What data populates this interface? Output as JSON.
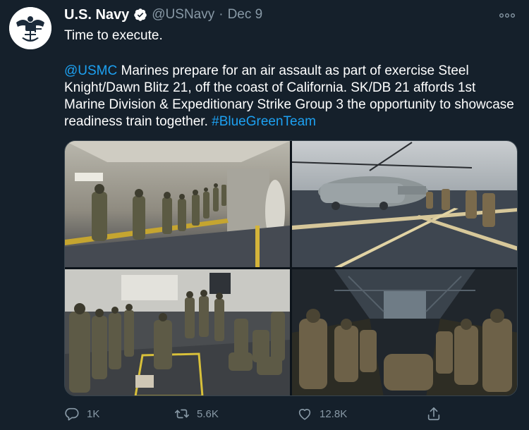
{
  "tweet": {
    "display_name": "U.S. Navy",
    "handle": "@USNavy",
    "separator": "·",
    "date": "Dec 9",
    "first_line": "Time to execute.",
    "mention": "@USMC",
    "body": " Marines prepare for an air assault as part of exercise Steel Knight/Dawn Blitz 21, off the coast of California. SK/DB 21 affords 1st Marine Division & Expeditionary Strike Group 3 the opportunity to showcase readiness train together. ",
    "hashtag": "#BlueGreenTeam"
  },
  "icons": {
    "avatar": "navy-emblem-icon",
    "verified": "verified-badge-icon",
    "more": "more-options-icon",
    "reply": "reply-icon",
    "retweet": "retweet-icon",
    "like": "heart-icon",
    "share": "share-icon"
  },
  "media": {
    "photos": [
      {
        "subject": "marines-lined-up-in-ship-corridor"
      },
      {
        "subject": "helicopter-on-flight-deck"
      },
      {
        "subject": "marines-briefing-on-deck"
      },
      {
        "subject": "marines-inside-aircraft-cabin"
      }
    ]
  },
  "actions": {
    "reply_count": "1K",
    "retweet_count": "5.6K",
    "like_count": "12.8K"
  },
  "colors": {
    "background": "#15202b",
    "text": "#ffffff",
    "secondary_text": "#8899a6",
    "link": "#1da1f2",
    "border": "#38444d"
  }
}
